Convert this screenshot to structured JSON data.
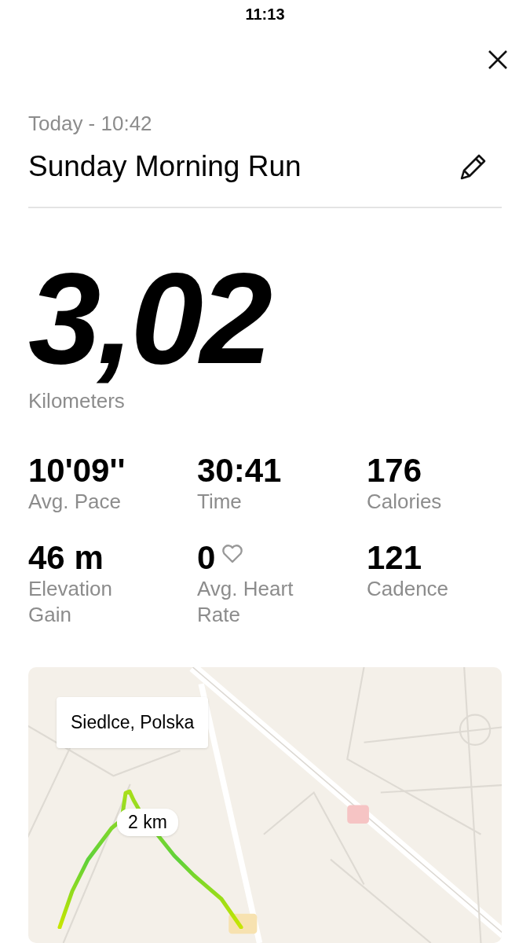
{
  "status_bar": {
    "time": "11:13"
  },
  "header": {
    "date": "Today - 10:42",
    "title": "Sunday Morning Run"
  },
  "distance": {
    "value": "3,02",
    "unit": "Kilometers"
  },
  "stats": [
    {
      "value": "10'09''",
      "label": "Avg. Pace",
      "kind": "plain"
    },
    {
      "value": "30:41",
      "label": "Time",
      "kind": "plain"
    },
    {
      "value": "176",
      "label": "Calories",
      "kind": "plain"
    },
    {
      "value": "46 m",
      "label": "Elevation Gain",
      "kind": "plain"
    },
    {
      "value": "0",
      "label": "Avg. Heart Rate",
      "kind": "heart"
    },
    {
      "value": "121",
      "label": "Cadence",
      "kind": "plain"
    }
  ],
  "map": {
    "location": "Siedlce, Polska",
    "marker": "2 km"
  }
}
